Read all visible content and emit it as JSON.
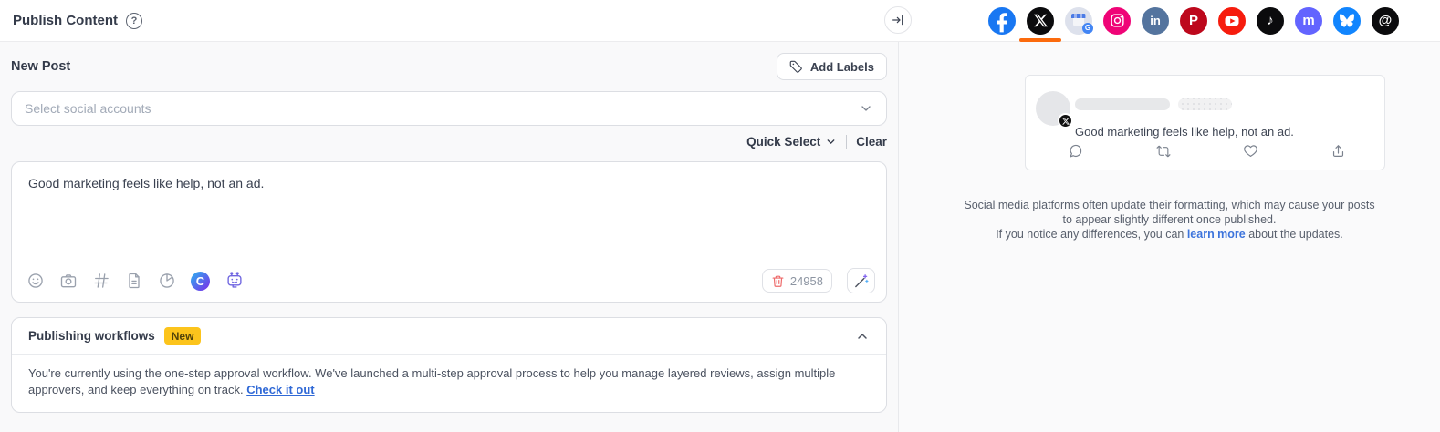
{
  "header": {
    "title": "Publish Content",
    "help_icon": "question-circle",
    "collapse_icon": "arrow-to-bar"
  },
  "left_panel": {
    "new_post_title": "New Post",
    "add_labels_button": "Add Labels",
    "account_select": {
      "placeholder": "Select social accounts"
    },
    "quick_select_label": "Quick Select",
    "clear_label": "Clear",
    "composer": {
      "text": "Good marketing feels like help, not an ad.",
      "char_count": "24958",
      "toolbar_icons": [
        "emoji",
        "camera",
        "hashtag",
        "document",
        "pie-chart",
        "canva",
        "ai-robot"
      ],
      "trash_icon": "trash",
      "magic_icon": "magic-wand"
    },
    "workflows": {
      "title": "Publishing workflows",
      "badge": "New",
      "body_text": "You're currently using the one-step approval workflow. We've launched a multi-step approval process to help you manage layered reviews, assign multiple approvers, and keep everything on track.",
      "link_text": "Check it out"
    }
  },
  "right_panel": {
    "networks": [
      {
        "name": "facebook",
        "color": "#1877F2",
        "selected": false
      },
      {
        "name": "x-twitter",
        "color": "#000000",
        "selected": true
      },
      {
        "name": "google-business",
        "color": "#dde1ec",
        "selected": false
      },
      {
        "name": "instagram",
        "color": "#ef0477",
        "selected": false
      },
      {
        "name": "linkedin",
        "color": "#54749e",
        "selected": false
      },
      {
        "name": "pinterest",
        "color": "#bd081c",
        "selected": false
      },
      {
        "name": "youtube",
        "color": "#f61c0d",
        "selected": false
      },
      {
        "name": "tiktok",
        "color": "#000000",
        "selected": false
      },
      {
        "name": "mastodon",
        "color": "#6364FF",
        "selected": false
      },
      {
        "name": "bluesky",
        "color": "#1185FE",
        "selected": false
      },
      {
        "name": "threads",
        "color": "#000000",
        "selected": false
      }
    ],
    "network_glyphs": {
      "linkedin": "in",
      "pinterest": "P",
      "tiktok": "♪",
      "mastodon": "m",
      "threads": "@",
      "google_badge": "G",
      "canva": "C"
    },
    "preview": {
      "post_text": "Good marketing feels like help, not an ad.",
      "network_badge": "x-twitter",
      "actions": [
        "reply",
        "repost",
        "like",
        "share"
      ]
    },
    "disclaimer": {
      "sentence1": "Social media platforms often update their formatting, which may cause your posts to appear slightly different once published.",
      "line2_prefix": "If you notice any differences, you can ",
      "link": "learn more",
      "line2_suffix": " about the updates."
    }
  },
  "colors": {
    "accent_orange": "#fb6a0d",
    "badge_yellow": "#fcc41c",
    "link_blue": "#3069d6",
    "danger_red": "#ee6b6b"
  }
}
